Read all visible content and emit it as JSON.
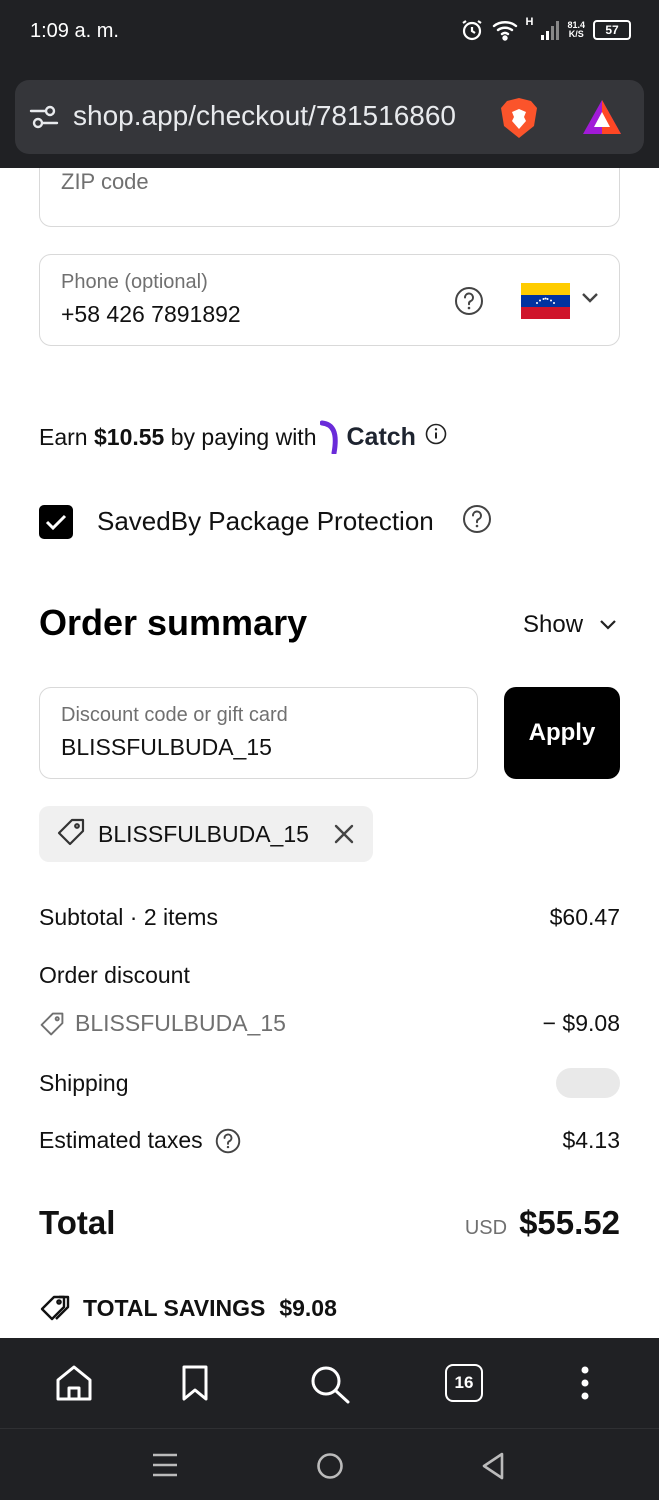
{
  "status_bar": {
    "time": "1:09 a. m.",
    "network_type": "H",
    "net_speed_value": "81.4",
    "net_speed_unit": "K/S",
    "battery": "57"
  },
  "browser": {
    "url": "shop.app/checkout/781516860",
    "tab_count": "16"
  },
  "form": {
    "zip_placeholder": "ZIP code",
    "phone_label": "Phone (optional)",
    "phone_value": "+58 426 7891892"
  },
  "catch": {
    "earn_prefix": "Earn ",
    "earn_amount": "$10.55",
    "earn_suffix": " by paying with",
    "brand": "Catch"
  },
  "package_protection": {
    "label": "SavedBy Package Protection",
    "checked": true
  },
  "summary": {
    "title": "Order summary",
    "toggle": "Show",
    "discount_label": "Discount code or gift card",
    "discount_value": "BLISSFULBUDA_15",
    "apply": "Apply",
    "applied_code": "BLISSFULBUDA_15",
    "subtotal_label": "Subtotal · 2 items",
    "subtotal_value": "$60.47",
    "order_discount_label": "Order discount",
    "discount_code": "BLISSFULBUDA_15",
    "discount_amount": "− $9.08",
    "shipping_label": "Shipping",
    "taxes_label": "Estimated taxes",
    "taxes_value": "$4.13",
    "total_label": "Total",
    "currency": "USD",
    "total_value": "$55.52",
    "savings_label": "TOTAL SAVINGS",
    "savings_value": "$9.08"
  },
  "colors": {
    "apply_bg": "#000000",
    "browser_chrome": "#202124",
    "flag_yellow": "#FFCC00",
    "flag_blue": "#0033A0",
    "flag_red": "#CF142B",
    "catch_purple": "#6a2bd9"
  }
}
